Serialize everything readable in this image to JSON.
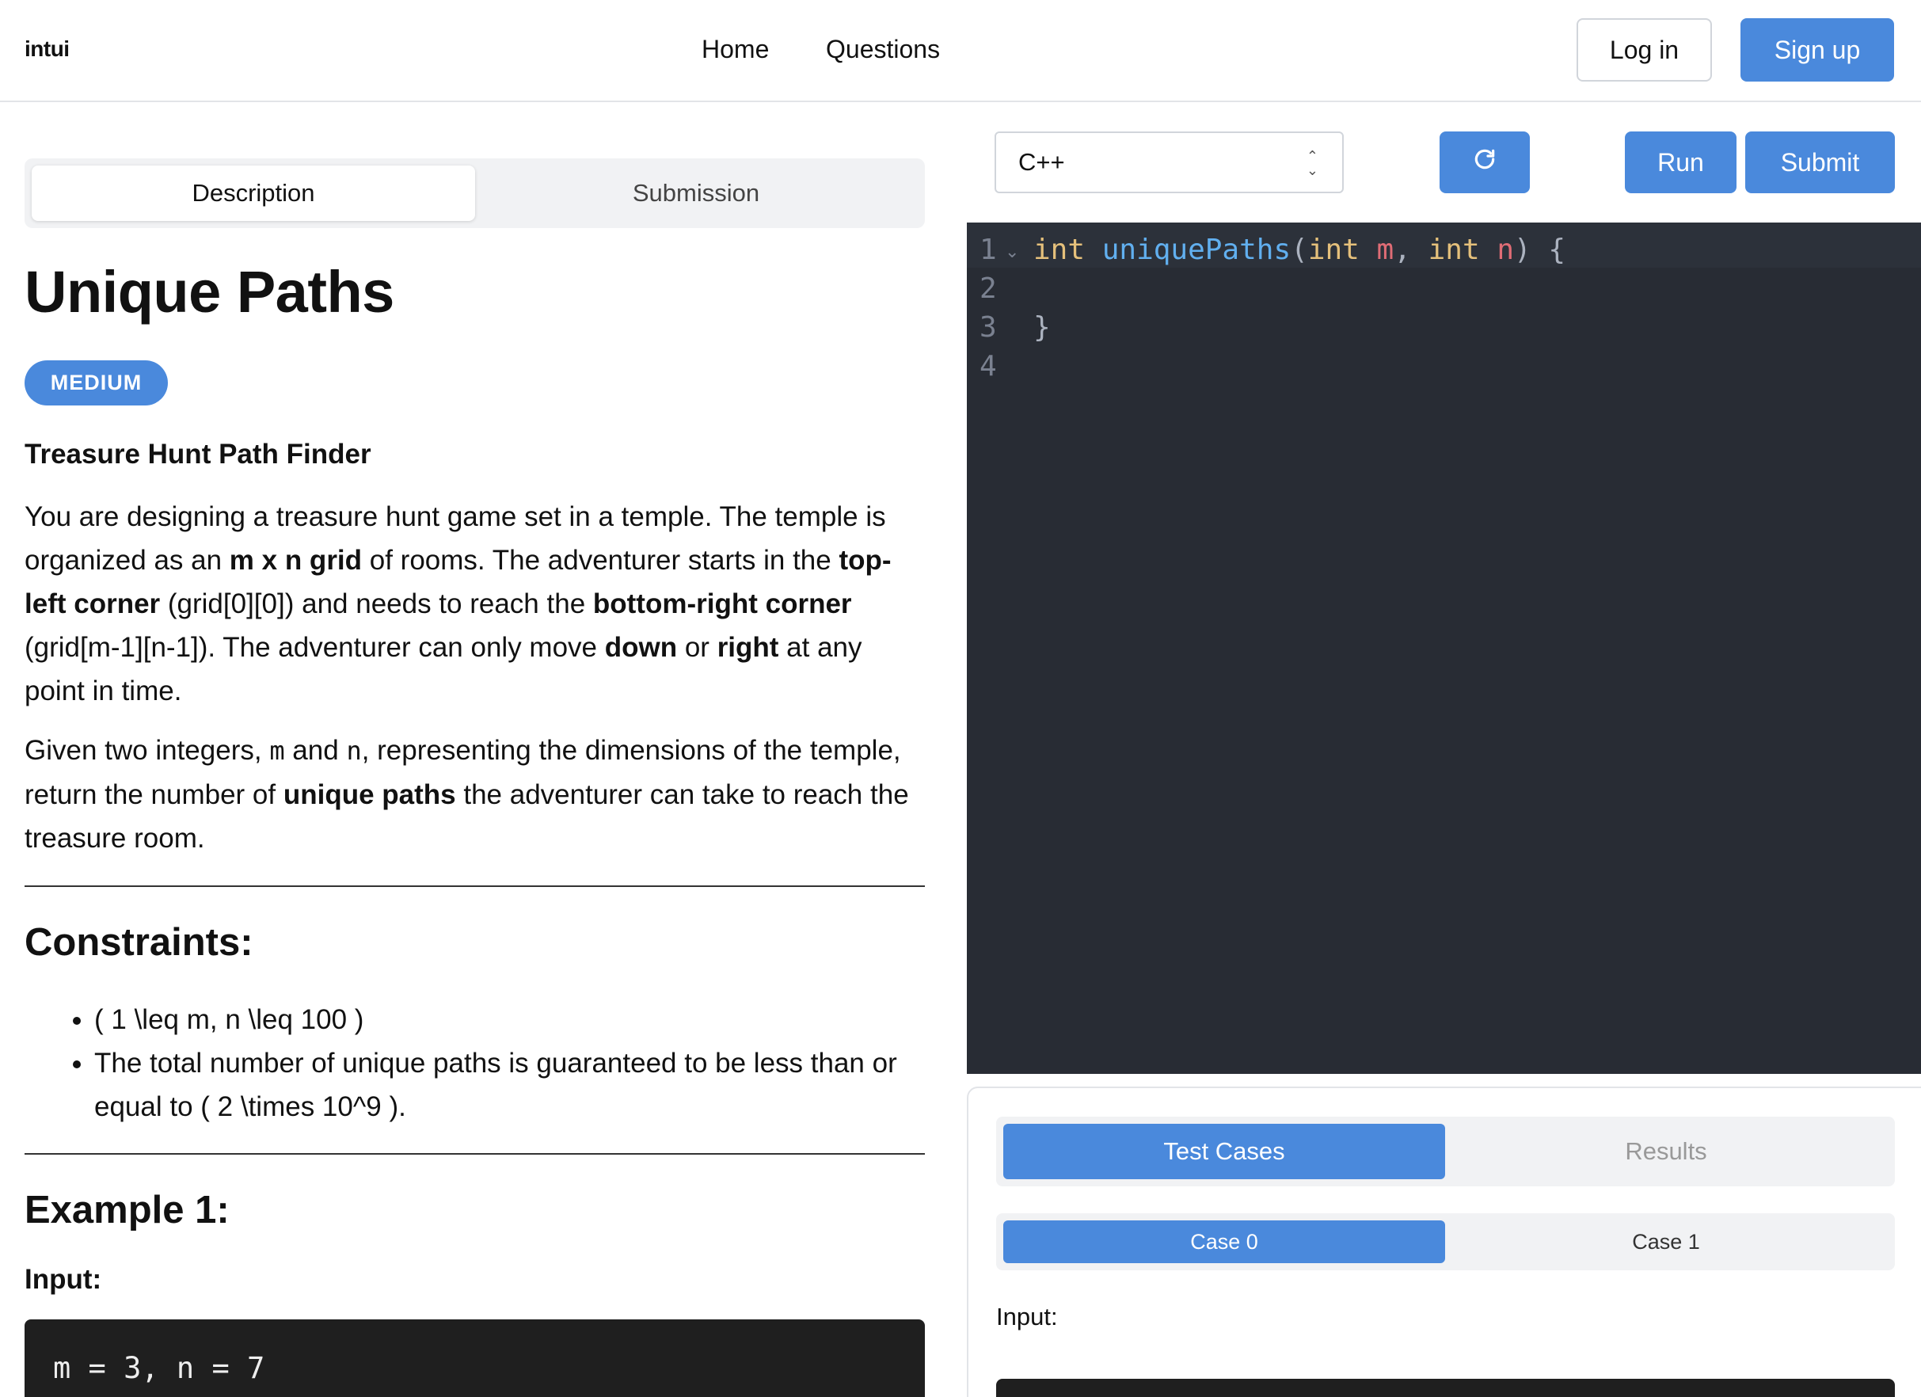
{
  "header": {
    "logo": "intui",
    "nav": [
      "Home",
      "Questions"
    ],
    "login_label": "Log in",
    "signup_label": "Sign up"
  },
  "left": {
    "tabs": [
      {
        "label": "Description",
        "active": true
      },
      {
        "label": "Submission",
        "active": false
      }
    ],
    "title": "Unique Paths",
    "difficulty": "MEDIUM",
    "subtitle": "Treasure Hunt Path Finder",
    "p1": {
      "t1": "You are designing a treasure hunt game set in a temple. The temple is organized as an ",
      "b1": "m x n grid",
      "t2": " of rooms. The adventurer starts in the ",
      "b2": "top-left corner",
      "t3": " (grid[0][0]) and needs to reach the ",
      "b3": "bottom-right corner",
      "t4": " (grid[m-1][n-1]). The adventurer can only move ",
      "b4": "down",
      "t5": " or ",
      "b5": "right",
      "t6": " at any point in time."
    },
    "p2": {
      "t1": "Given two integers, ",
      "m": "m",
      "t2": " and ",
      "n": "n",
      "t3": ", representing the dimensions of the temple, return the number of ",
      "b1": "unique paths",
      "t4": " the adventurer can take to reach the treasure room."
    },
    "constraints_heading": "Constraints:",
    "constraints": [
      "( 1 \\leq m, n \\leq 100 )",
      "The total number of unique paths is guaranteed to be less than or equal to ( 2 \\times 10^9 )."
    ],
    "example_heading": "Example 1:",
    "input_label": "Input:",
    "example_input": "m = 3, n = 7"
  },
  "right": {
    "language": "C++",
    "refresh_icon": "refresh-icon",
    "run_label": "Run",
    "submit_label": "Submit",
    "line_numbers": [
      "1",
      "2",
      "3",
      "4"
    ],
    "code": {
      "kw1": "int",
      "fn": "uniquePaths",
      "paren_open": "(",
      "kw2": "int",
      "m": "m",
      "comma": ", ",
      "kw3": "int",
      "n": "n",
      "paren_close": ") {",
      "close_brace": "}"
    },
    "panel_tabs": [
      {
        "label": "Test Cases",
        "active": true
      },
      {
        "label": "Results",
        "active": false
      }
    ],
    "cases": [
      {
        "label": "Case 0",
        "active": true
      },
      {
        "label": "Case 1",
        "active": false
      }
    ],
    "input_label": "Input:"
  },
  "colors": {
    "accent": "#4a89dc",
    "editor_bg": "#282c34",
    "keyword": "#e5c07b",
    "function": "#61afef",
    "variable": "#e06c75"
  }
}
